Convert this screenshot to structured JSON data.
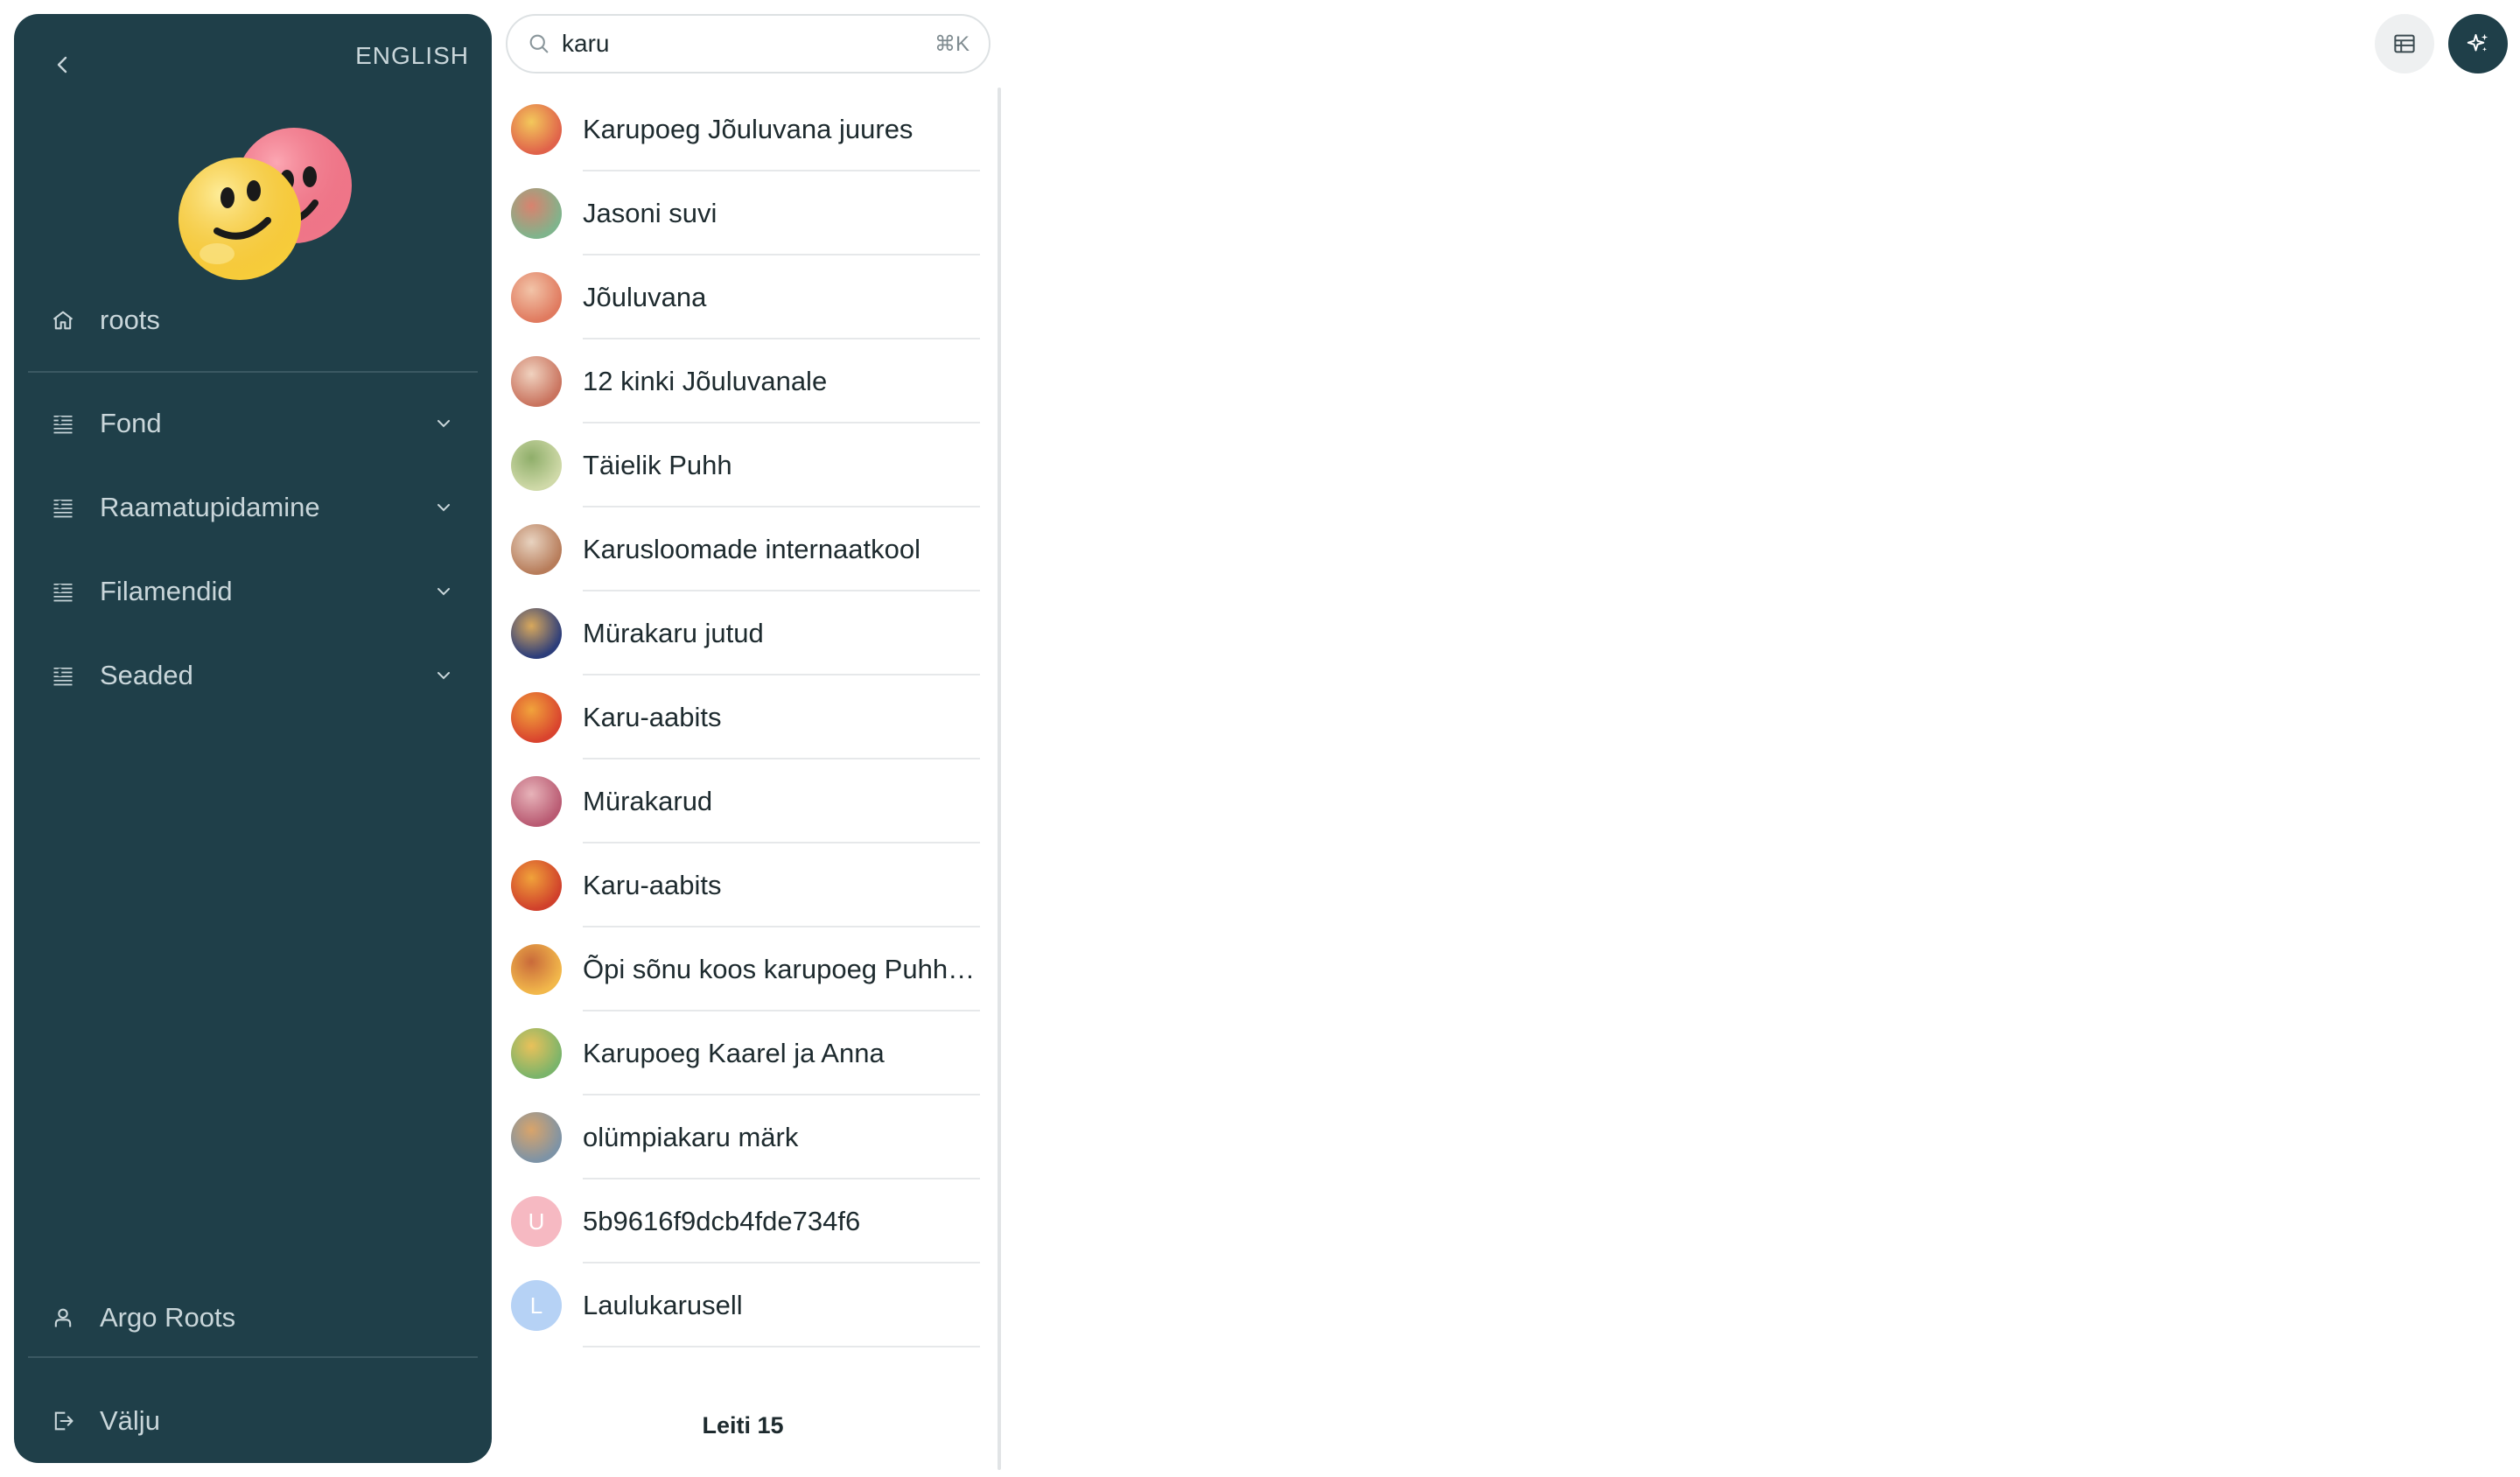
{
  "sidebar": {
    "language_toggle": "ENGLISH",
    "home": {
      "label": "roots",
      "icon": "home-icon"
    },
    "menu": [
      {
        "label": "Fond",
        "icon": "list-icon",
        "expandable": true
      },
      {
        "label": "Raamatupidamine",
        "icon": "list-icon",
        "expandable": true
      },
      {
        "label": "Filamendid",
        "icon": "list-icon",
        "expandable": true
      },
      {
        "label": "Seaded",
        "icon": "list-icon",
        "expandable": true
      }
    ],
    "user": {
      "label": "Argo Roots",
      "icon": "user-icon"
    },
    "logout": {
      "label": "Välju",
      "icon": "logout-icon"
    }
  },
  "search": {
    "value": "karu",
    "shortcut": "⌘K"
  },
  "results": [
    {
      "title": "Karupoeg Jõuluvana juures",
      "thumb_colors": [
        "#e0624a",
        "#f3c85b"
      ]
    },
    {
      "title": "Jasoni suvi",
      "thumb_colors": [
        "#7fb48c",
        "#d9826e"
      ]
    },
    {
      "title": "Jõuluvana",
      "thumb_colors": [
        "#e07a5f",
        "#f2c4a8"
      ]
    },
    {
      "title": "12 kinki Jõuluvanale",
      "thumb_colors": [
        "#c9735e",
        "#f0d2bf"
      ]
    },
    {
      "title": "Täielik Puhh",
      "thumb_colors": [
        "#cfd9a8",
        "#8fae6a"
      ]
    },
    {
      "title": "Karusloomade internaatkool",
      "thumb_colors": [
        "#b77c5a",
        "#e8d3c0"
      ]
    },
    {
      "title": "Mürakaru jutud",
      "thumb_colors": [
        "#2c3d7a",
        "#d8a85c"
      ]
    },
    {
      "title": "Karu-aabits",
      "thumb_colors": [
        "#d9432e",
        "#f1a33b"
      ]
    },
    {
      "title": "Mürakarud",
      "thumb_colors": [
        "#b95a72",
        "#e7b3b9"
      ]
    },
    {
      "title": "Karu-aabits",
      "thumb_colors": [
        "#d0402b",
        "#f0a23a"
      ]
    },
    {
      "title": "Õpi sõnu koos karupoeg Puhhiga",
      "thumb_colors": [
        "#f2b84b",
        "#c96a3a"
      ]
    },
    {
      "title": "Karupoeg Kaarel ja Anna",
      "thumb_colors": [
        "#7ab46a",
        "#e9c15a"
      ]
    },
    {
      "title": "olümpiakaru märk",
      "thumb_colors": [
        "#7d93a6",
        "#d9a46a"
      ]
    },
    {
      "title": "5b9616f9dcb4fde734f6",
      "letter": "U",
      "thumb_colors": [
        "#f6b9c2",
        "#f6b9c2"
      ]
    },
    {
      "title": "Laulukarusell",
      "letter": "L",
      "thumb_colors": [
        "#b6d2f5",
        "#b6d2f5"
      ]
    }
  ],
  "footer": {
    "count_label": "Leiti 15"
  },
  "toolbar": {
    "table_view_icon": "table-icon",
    "ai_icon": "sparkles-icon"
  },
  "colors": {
    "sidebar_bg": "#1f3f49",
    "sidebar_text": "#c9d6da",
    "ai_button_bg": "#1f3f49"
  }
}
